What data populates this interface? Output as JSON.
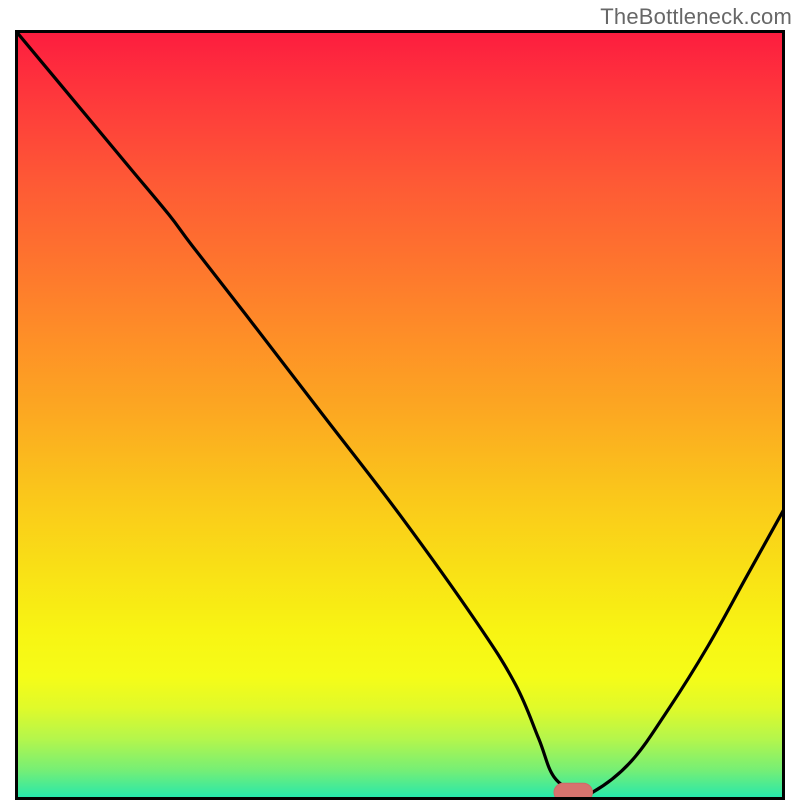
{
  "header": {
    "domain_url": "TheBottleneck.com"
  },
  "colors": {
    "label_text": "#676767",
    "curve": "#000000",
    "frame": "#020202",
    "marker_fill": "#d6736e",
    "marker_stroke": "#ce6968"
  },
  "gradient_stops": [
    {
      "offset": 0.0,
      "color": "#fd1c3f"
    },
    {
      "offset": 0.1,
      "color": "#fe3c3b"
    },
    {
      "offset": 0.2,
      "color": "#fe5a35"
    },
    {
      "offset": 0.3,
      "color": "#fe742e"
    },
    {
      "offset": 0.4,
      "color": "#fe8f27"
    },
    {
      "offset": 0.5,
      "color": "#fca921"
    },
    {
      "offset": 0.6,
      "color": "#fac61b"
    },
    {
      "offset": 0.7,
      "color": "#f9e016"
    },
    {
      "offset": 0.78,
      "color": "#f8f413"
    },
    {
      "offset": 0.84,
      "color": "#f5fc18"
    },
    {
      "offset": 0.88,
      "color": "#e0fa2a"
    },
    {
      "offset": 0.92,
      "color": "#b5f64b"
    },
    {
      "offset": 0.96,
      "color": "#78ef74"
    },
    {
      "offset": 0.99,
      "color": "#36e9a2"
    },
    {
      "offset": 1.0,
      "color": "#1ce7b5"
    }
  ],
  "chart_data": {
    "type": "line",
    "title": "",
    "xlabel": "",
    "ylabel": "",
    "xlim": [
      0,
      100
    ],
    "ylim": [
      0,
      100
    ],
    "x": [
      0,
      5,
      10,
      15,
      20,
      23,
      30,
      40,
      50,
      60,
      65,
      68,
      70,
      73,
      75,
      80,
      85,
      90,
      95,
      100
    ],
    "values": [
      100,
      94,
      88,
      82,
      76,
      72,
      63,
      50,
      37,
      23,
      15,
      8,
      3,
      1,
      1,
      5,
      12,
      20,
      29,
      38
    ],
    "marker": {
      "x_range": [
        70,
        75
      ],
      "y": 1
    }
  }
}
